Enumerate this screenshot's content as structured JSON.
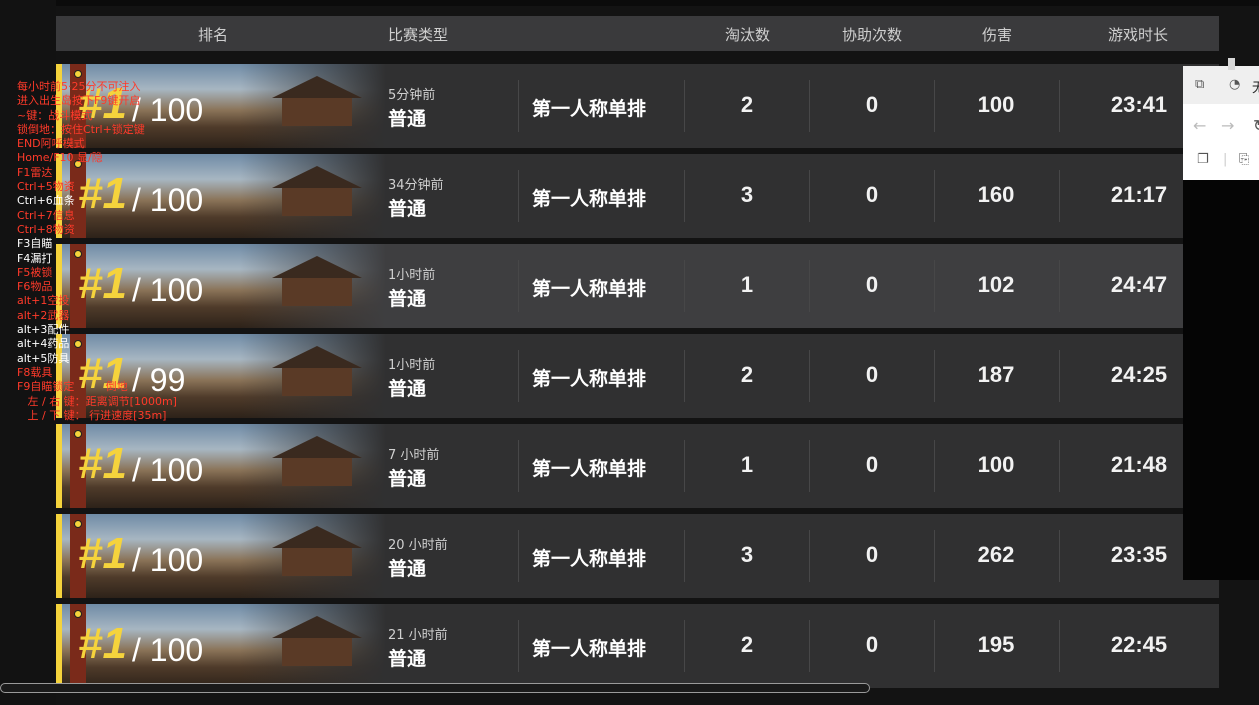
{
  "header": {
    "rank": "排名",
    "match_type": "比赛类型",
    "kills": "淘汰数",
    "assists": "协助次数",
    "damage": "伤害",
    "duration": "游戏时长"
  },
  "rows": [
    {
      "rank": "#1",
      "total": "/ 100",
      "ago": "5分钟前",
      "mode": "普通",
      "type": "第一人称单排",
      "kills": "2",
      "assists": "0",
      "damage": "100",
      "time": "23:41"
    },
    {
      "rank": "#1",
      "total": "/ 100",
      "ago": "34分钟前",
      "mode": "普通",
      "type": "第一人称单排",
      "kills": "3",
      "assists": "0",
      "damage": "160",
      "time": "21:17"
    },
    {
      "rank": "#1",
      "total": "/ 100",
      "ago": "1小时前",
      "mode": "普通",
      "type": "第一人称单排",
      "kills": "1",
      "assists": "0",
      "damage": "102",
      "time": "24:47"
    },
    {
      "rank": "#1",
      "total": "/ 99",
      "ago": "1小时前",
      "mode": "普通",
      "type": "第一人称单排",
      "kills": "2",
      "assists": "0",
      "damage": "187",
      "time": "24:25"
    },
    {
      "rank": "#1",
      "total": "/ 100",
      "ago": "7 小时前",
      "mode": "普通",
      "type": "第一人称单排",
      "kills": "1",
      "assists": "0",
      "damage": "100",
      "time": "21:48"
    },
    {
      "rank": "#1",
      "total": "/ 100",
      "ago": "20 小时前",
      "mode": "普通",
      "type": "第一人称单排",
      "kills": "3",
      "assists": "0",
      "damage": "262",
      "time": "23:35"
    },
    {
      "rank": "#1",
      "total": "/ 100",
      "ago": "21 小时前",
      "mode": "普通",
      "type": "第一人称单排",
      "kills": "2",
      "assists": "0",
      "damage": "195",
      "time": "22:45"
    }
  ],
  "overlay_lines": [
    "每小时前5·25分不可注入",
    "进入出生岛按下F9键开启",
    "~键：战斗模式",
    "锁倒地：按住Ctrl+锁定键",
    "END阿呼模式",
    "Home/F10 显/隐",
    "F1雷达",
    "Ctrl+5物资",
    "Ctrl+6血条",
    "Ctrl+7信息",
    "Ctrl+8物资",
    "F3自瞄",
    "F4漏打",
    "F5被锁",
    "F6物品",
    "alt+1空投",
    "alt+2武器",
    "alt+3配件",
    "alt+4药品",
    "alt+5防具",
    "F8载具",
    "F9自瞄锁定         倒地",
    "   左 / 右 键：距离调节[1000m]",
    "   上 / 下 键： 行进速度[35m]"
  ],
  "overlay_white_lines": [
    8,
    11,
    12,
    17,
    18,
    19
  ],
  "colors": {
    "accent": "#f5d33c",
    "overlay_text": "#ff3a2a"
  },
  "popup": {
    "tab_title": "无"
  }
}
